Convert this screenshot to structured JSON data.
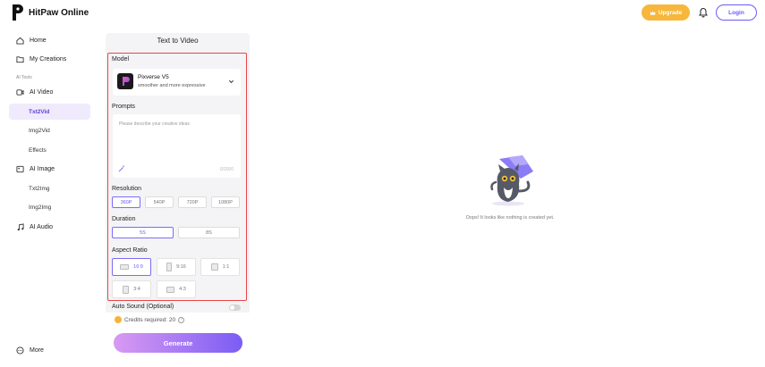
{
  "header": {
    "brand": "HitPaw Online",
    "upgrade_label": "Upgrade",
    "login_label": "Login",
    "colors": {
      "upgrade": "#f6b73c",
      "accent": "#6b5cf6"
    }
  },
  "sidebar": {
    "home": "Home",
    "my_creations": "My Creations",
    "section_label": "AI Tools",
    "ai_video": "AI Video",
    "txt2vid": "Txt2Vid",
    "img2vid": "Img2Vid",
    "effects": "Effects",
    "ai_image": "AI Image",
    "txt2img": "Txt2Img",
    "img2img": "Img2Img",
    "ai_audio": "AI Audio",
    "more": "More"
  },
  "panel": {
    "title": "Text to Video",
    "model_label": "Model",
    "model_name": "Pixverse V5",
    "model_desc": "smoother and more expressive",
    "prompts_label": "Prompts",
    "prompt_placeholder": "Please describe your creative ideas",
    "prompt_counter": "0/2000",
    "resolution_label": "Resolution",
    "resolutions": [
      "360P",
      "540P",
      "720P",
      "1080P"
    ],
    "selected_resolution": "360P",
    "duration_label": "Duration",
    "durations": [
      "5S",
      "8S"
    ],
    "selected_duration": "5S",
    "aspect_label": "Aspect Ratio",
    "aspects": [
      "16:9",
      "9:16",
      "1:1",
      "3:4",
      "4:3"
    ],
    "selected_aspect": "16:9",
    "auto_sound_label": "Auto Sound (Optional)",
    "credits_label": "Credits required: 20",
    "generate_label": "Generate"
  },
  "empty_state": {
    "message": "Oops! It looks like nothing is created yet."
  }
}
